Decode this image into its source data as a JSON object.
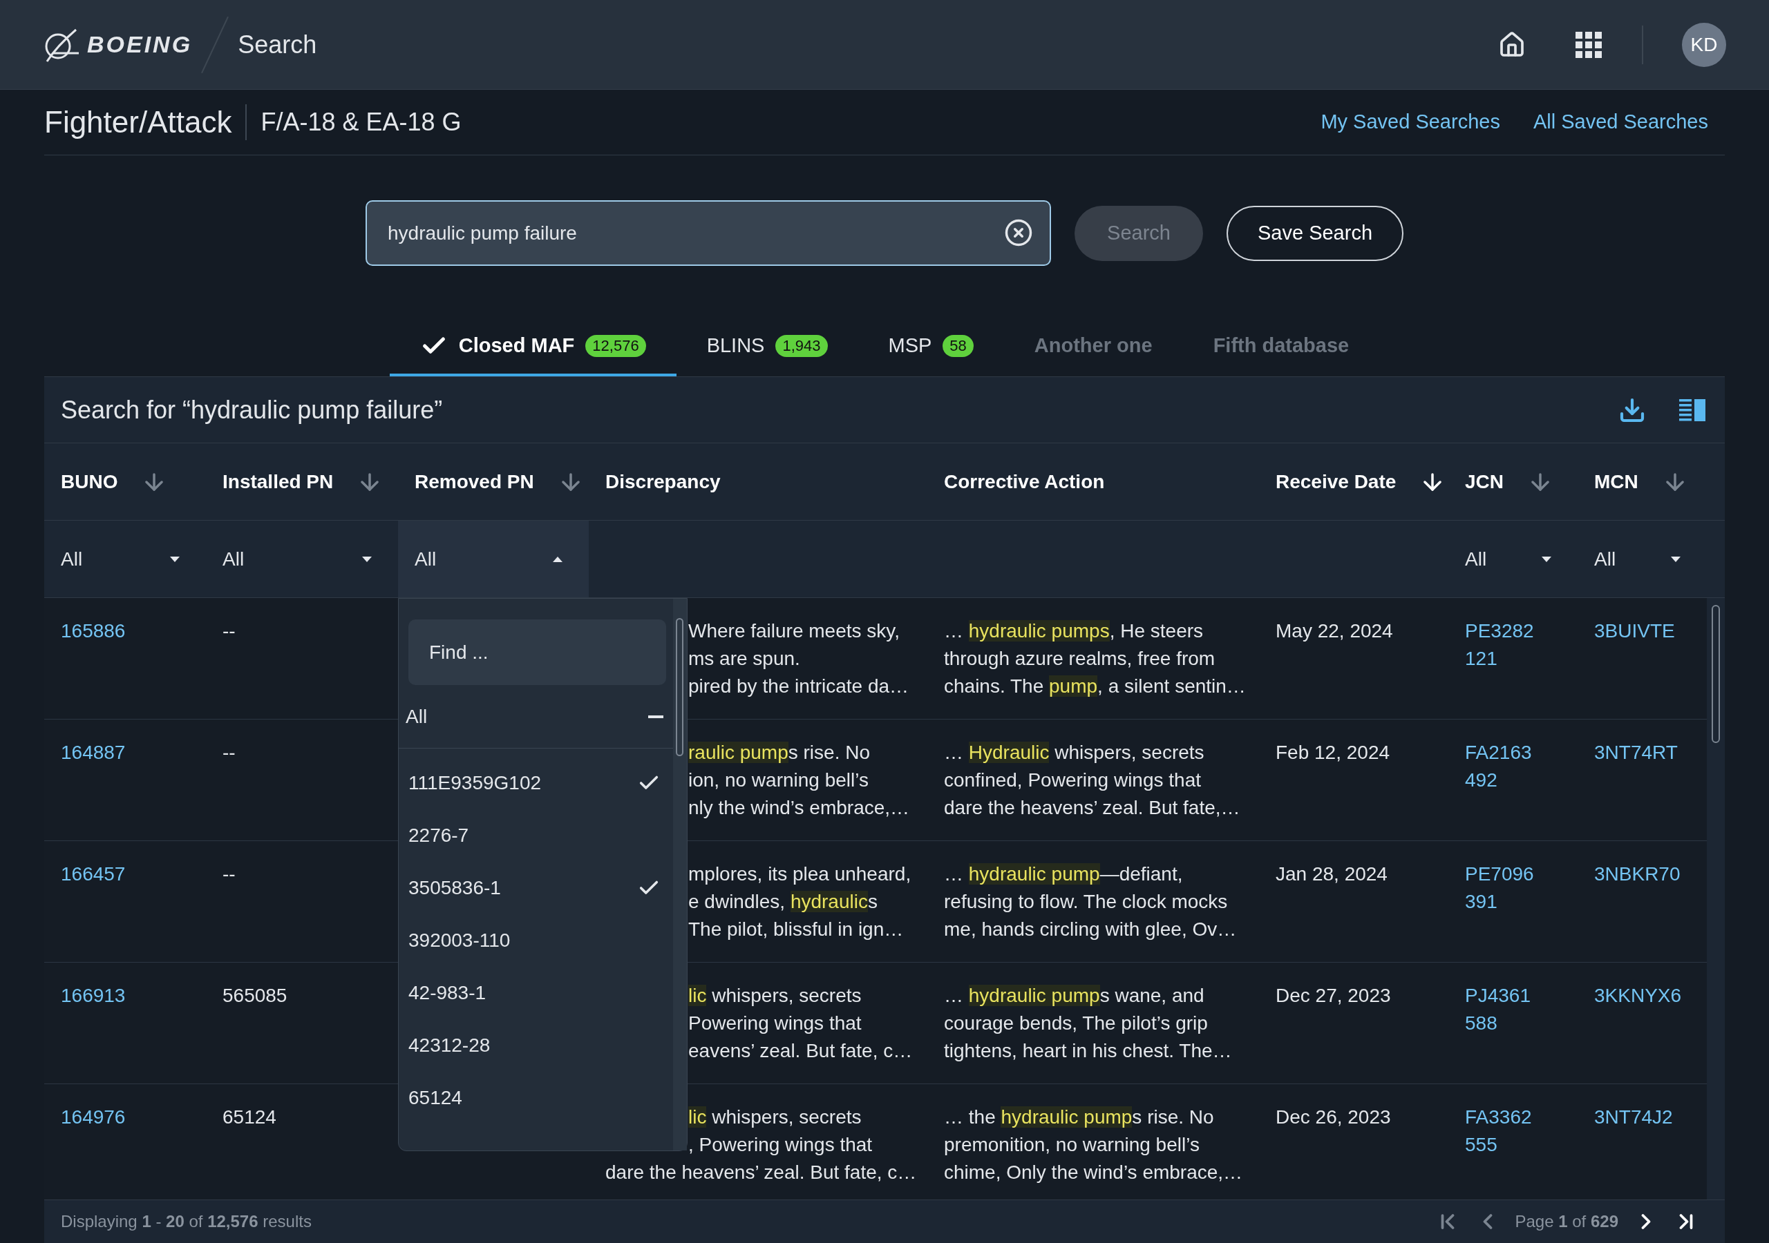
{
  "header": {
    "logo_text": "BOEING",
    "app_title": "Search",
    "avatar": "KD"
  },
  "breadcrumb": {
    "category": "Fighter/Attack",
    "aircraft": "F/A-18 & EA-18 G"
  },
  "links": [
    "My Saved Searches",
    "All Saved Searches"
  ],
  "search": {
    "value": "hydraulic pump failure",
    "search_button": {
      "label": "Search",
      "disabled": true
    },
    "save_button": "Save Search"
  },
  "tabs": [
    {
      "label": "Closed MAF",
      "count": "12,576",
      "selected": true,
      "disabled": false
    },
    {
      "label": "BLINS",
      "count": "1,943",
      "selected": false,
      "disabled": false
    },
    {
      "label": "MSP",
      "count": "58",
      "selected": false,
      "disabled": false
    },
    {
      "label": "Another one",
      "selected": false,
      "disabled": true
    },
    {
      "label": "Fifth database",
      "selected": false,
      "disabled": true
    }
  ],
  "results": {
    "title": "Search for “hydraulic pump failure”",
    "columns": [
      {
        "label": "BUNO",
        "sort_active": false,
        "filter": {
          "value": "All",
          "open": false
        }
      },
      {
        "label": "Installed PN",
        "sort_active": false,
        "filter": {
          "value": "All",
          "open": false
        }
      },
      {
        "label": "Removed PN",
        "sort_active": false,
        "filter": {
          "value": "All",
          "open": true
        }
      },
      {
        "label": "Discrepancy"
      },
      {
        "label": "Corrective Action"
      },
      {
        "label": "Receive Date",
        "sort_active": true
      },
      {
        "label": "JCN",
        "sort_active": false,
        "filter": {
          "value": "All",
          "open": false
        }
      },
      {
        "label": "MCN",
        "sort_active": false,
        "filter": {
          "value": "All",
          "open": false
        }
      }
    ],
    "rows": [
      {
        "buno": "165886",
        "installed_pn": "--",
        "discrepancy": [
          {
            "covered": true,
            "parts": [
              {
                "text": "Where failure meets sky,",
                "highlight": false
              }
            ]
          },
          {
            "covered": true,
            "parts": [
              {
                "text": "ms are spun.",
                "highlight": false
              }
            ]
          },
          {
            "covered": true,
            "parts": [
              {
                "text": "pired by the intricate da…",
                "highlight": false
              }
            ]
          }
        ],
        "corrective_action": [
          [
            {
              "text": "… ",
              "highlight": false
            },
            {
              "text": "hydraulic pumps",
              "highlight": true
            },
            {
              "text": ", He steers",
              "highlight": false
            }
          ],
          [
            {
              "text": "through azure realms, free from",
              "highlight": false
            }
          ],
          [
            {
              "text": "chains. The ",
              "highlight": false
            },
            {
              "text": "pump",
              "highlight": true
            },
            {
              "text": ", a silent sentin…",
              "highlight": false
            }
          ]
        ],
        "receive_date": "May 22, 2024",
        "jcn": [
          "PE3282",
          "121"
        ],
        "mcn": "3BUIVTE"
      },
      {
        "buno": "164887",
        "installed_pn": "--",
        "discrepancy": [
          {
            "covered": true,
            "parts": [
              {
                "text": "raulic pump",
                "highlight": true
              },
              {
                "text": "s rise. No",
                "highlight": false
              }
            ]
          },
          {
            "covered": true,
            "parts": [
              {
                "text": "ion, no warning bell’s",
                "highlight": false
              }
            ]
          },
          {
            "covered": true,
            "parts": [
              {
                "text": "nly the wind’s embrace,…",
                "highlight": false
              }
            ]
          }
        ],
        "corrective_action": [
          [
            {
              "text": "… ",
              "highlight": false
            },
            {
              "text": "Hydraulic",
              "highlight": true
            },
            {
              "text": " whispers, secrets",
              "highlight": false
            }
          ],
          [
            {
              "text": "confined, Powering wings that",
              "highlight": false
            }
          ],
          [
            {
              "text": "dare the heavens’ zeal. But fate,…",
              "highlight": false
            }
          ]
        ],
        "receive_date": "Feb 12, 2024",
        "jcn": [
          "FA2163",
          "492"
        ],
        "mcn": "3NT74RT"
      },
      {
        "buno": "166457",
        "installed_pn": "--",
        "discrepancy": [
          {
            "covered": true,
            "parts": [
              {
                "text": "mplores, its plea unheard,",
                "highlight": false
              }
            ]
          },
          {
            "covered": true,
            "parts": [
              {
                "text": "e dwindles, ",
                "highlight": false
              },
              {
                "text": "hydraulic",
                "highlight": true
              },
              {
                "text": "s",
                "highlight": false
              }
            ]
          },
          {
            "covered": true,
            "parts": [
              {
                "text": "The pilot, blissful in ign…",
                "highlight": false
              }
            ]
          }
        ],
        "corrective_action": [
          [
            {
              "text": "… ",
              "highlight": false
            },
            {
              "text": "hydraulic pump",
              "highlight": true
            },
            {
              "text": "—defiant,",
              "highlight": false
            }
          ],
          [
            {
              "text": "refusing to flow. The clock mocks",
              "highlight": false
            }
          ],
          [
            {
              "text": "me, hands circling with glee, Ov…",
              "highlight": false
            }
          ]
        ],
        "receive_date": "Jan 28, 2024",
        "jcn": [
          "PE7096",
          "391"
        ],
        "mcn": "3NBKR70"
      },
      {
        "buno": "166913",
        "installed_pn": "565085",
        "discrepancy": [
          {
            "covered": true,
            "parts": [
              {
                "text": "lic",
                "highlight": true
              },
              {
                "text": " whispers, secrets",
                "highlight": false
              }
            ]
          },
          {
            "covered": true,
            "parts": [
              {
                "text": "Powering wings that",
                "highlight": false
              }
            ]
          },
          {
            "covered": true,
            "parts": [
              {
                "text": "eavens’ zeal. But fate, c…",
                "highlight": false
              }
            ]
          }
        ],
        "corrective_action": [
          [
            {
              "text": "… ",
              "highlight": false
            },
            {
              "text": "hydraulic pump",
              "highlight": true
            },
            {
              "text": "s wane, and",
              "highlight": false
            }
          ],
          [
            {
              "text": "courage bends, The pilot’s grip",
              "highlight": false
            }
          ],
          [
            {
              "text": "tightens, heart in his chest. The…",
              "highlight": false
            }
          ]
        ],
        "receive_date": "Dec 27, 2023",
        "jcn": [
          "PJ4361",
          "588"
        ],
        "mcn": "3KKNYX6"
      },
      {
        "buno": "164976",
        "installed_pn": "65124",
        "discrepancy": [
          {
            "covered": true,
            "parts": [
              {
                "text": "lic",
                "highlight": true
              },
              {
                "text": " whispers, secrets",
                "highlight": false
              }
            ]
          },
          {
            "covered": true,
            "parts": [
              {
                "text": ", Powering wings that",
                "highlight": false
              }
            ]
          },
          {
            "covered": false,
            "parts": [
              {
                "text": "dare the heavens’ zeal. But fate, c…",
                "highlight": false
              }
            ]
          }
        ],
        "corrective_action": [
          [
            {
              "text": "… the ",
              "highlight": false
            },
            {
              "text": "hydraulic pump",
              "highlight": true
            },
            {
              "text": "s rise. No",
              "highlight": false
            }
          ],
          [
            {
              "text": "premonition, no warning bell’s",
              "highlight": false
            }
          ],
          [
            {
              "text": "chime, Only the wind’s embrace,…",
              "highlight": false
            }
          ]
        ],
        "receive_date": "Dec 26, 2023",
        "jcn": [
          "FA3362",
          "555"
        ],
        "mcn": "3NT74J2"
      }
    ],
    "footer": {
      "displaying": "Displaying **1** - **20** of **12,576** results",
      "page": "Page **1** of **629**",
      "pager": [
        {
          "kind": "first",
          "disabled": true
        },
        {
          "kind": "prev",
          "disabled": true
        },
        {
          "kind": "next",
          "disabled": false
        },
        {
          "kind": "last",
          "disabled": false
        }
      ]
    }
  },
  "filter_dropdown": {
    "placeholder": "Find ...",
    "all_option": {
      "label": "All",
      "indeterminate": true
    },
    "options": [
      {
        "label": "111E9359G102",
        "checked": true
      },
      {
        "label": "2276-7",
        "checked": false
      },
      {
        "label": "3505836-1",
        "checked": true
      },
      {
        "label": "392003-110",
        "checked": false
      },
      {
        "label": "42-983-1",
        "checked": false
      },
      {
        "label": "42312-28",
        "checked": false
      },
      {
        "label": "65124",
        "checked": false
      }
    ]
  }
}
